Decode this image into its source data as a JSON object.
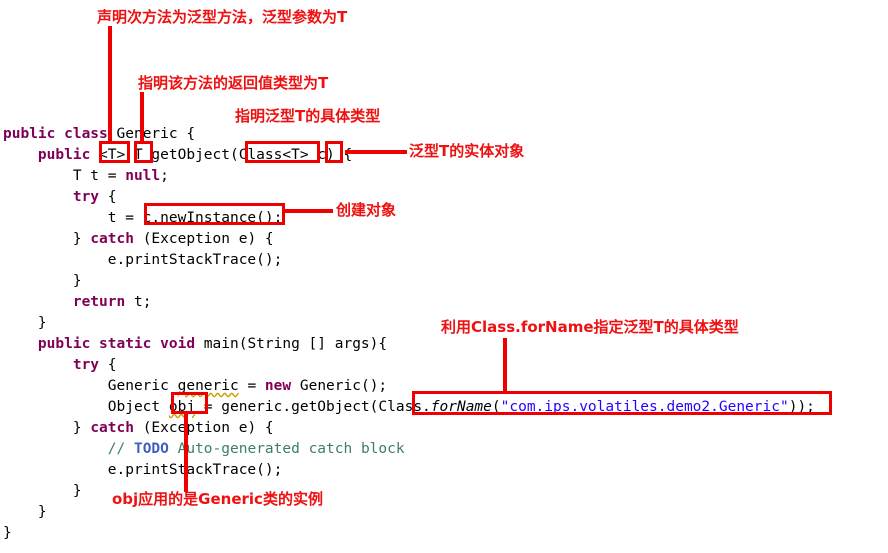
{
  "document": {
    "kind": "java-source-code-screenshot",
    "language": "Java"
  },
  "code": {
    "lines": [
      {
        "id": "l1",
        "text": "public class Generic {"
      },
      {
        "id": "l2",
        "text": "    public <T> T getObject(Class<T> c) {"
      },
      {
        "id": "l3",
        "text": "        T t = null;"
      },
      {
        "id": "l4",
        "text": "        try {"
      },
      {
        "id": "l5",
        "text": "            t = c.newInstance();"
      },
      {
        "id": "l6",
        "text": "        } catch (Exception e) {"
      },
      {
        "id": "l7",
        "text": "            e.printStackTrace();"
      },
      {
        "id": "l8",
        "text": "        }"
      },
      {
        "id": "l9",
        "text": "        return t;"
      },
      {
        "id": "l10",
        "text": "    }"
      },
      {
        "id": "l11",
        "text": ""
      },
      {
        "id": "l12",
        "text": "    public static void main(String [] args){"
      },
      {
        "id": "l13",
        "text": "        try {"
      },
      {
        "id": "l14",
        "text": "            Generic generic = new Generic();"
      },
      {
        "id": "l15",
        "text": "            Object obj = generic.getObject(Class.forName(\"com.ips.volatiles.demo2.Generic\"));"
      },
      {
        "id": "l16",
        "text": "        } catch (Exception e) {"
      },
      {
        "id": "l17",
        "text": "            // TODO Auto-generated catch block"
      },
      {
        "id": "l18",
        "text": "            e.printStackTrace();"
      },
      {
        "id": "l19",
        "text": "        }"
      },
      {
        "id": "l20",
        "text": "    }"
      },
      {
        "id": "l21",
        "text": "}"
      }
    ],
    "tokens": {
      "kw_public": "public",
      "kw_class": "class",
      "kw_static": "static",
      "kw_void": "void",
      "kw_null": "null",
      "kw_try": "try",
      "kw_catch": "catch",
      "kw_return": "return",
      "kw_new": "new",
      "type_generic": "Generic",
      "method_getObject": "getObject",
      "method_newInstance": "newInstance",
      "method_printStackTrace": "printStackTrace",
      "method_forName": "forName",
      "type_class": "Class",
      "type_object": "Object",
      "type_exception": "Exception",
      "type_string": "String",
      "var_t": "t",
      "var_c": "c",
      "var_e": "e",
      "var_obj": "obj",
      "var_generic": "generic",
      "var_args": "args",
      "type_param": "T",
      "string_literal": "\"com.ips.volatiles.demo2.Generic\"",
      "comment_todo": "// TODO Auto-generated catch block",
      "todo_word": "TODO"
    },
    "line_strings": {
      "l1_a": "public",
      "l1_b": " class ",
      "l1_c": "Generic {",
      "l2_a": "    public ",
      "l2_b": "<T> T ",
      "l2_c": "getObject(Class<T> c) {",
      "l3_a": "        T t = ",
      "l3_b": "null",
      "l3_c": ";",
      "l4_a": "        ",
      "l4_b": "try",
      "l4_c": " {",
      "l5_a": "            t = c.newInstance();",
      "l6_a": "        } ",
      "l6_b": "catch",
      "l6_c": " (Exception e) {",
      "l7_a": "            e.printStackTrace();",
      "l8_a": "        }",
      "l9_a": "        ",
      "l9_b": "return",
      "l9_c": " t;",
      "l10_a": "    }",
      "l12_a": "    ",
      "l12_b": "public static void ",
      "l12_c": "main(String [] args){",
      "l13_a": "        ",
      "l13_b": "try",
      "l13_c": " {",
      "l14_a": "            Generic ",
      "l14_b": "generic",
      "l14_c": " = ",
      "l14_d": "new",
      "l14_e": " Generic();",
      "l15_a": "            Object ",
      "l15_b": "obj",
      "l15_c": " = generic.getObject(Class.",
      "l15_d": "forName",
      "l15_e": "(",
      "l15_f": "\"com.ips.volatiles.demo2.Generic\"",
      "l15_g": "));",
      "l16_a": "        } ",
      "l16_b": "catch",
      "l16_c": " (Exception e) {",
      "l17_a": "            ",
      "l17_b": "// ",
      "l17_c": "TODO",
      "l17_d": " Auto-generated catch block",
      "l18_a": "            e.printStackTrace();",
      "l19_a": "        }",
      "l20_a": "    }",
      "l21_a": "}"
    }
  },
  "annotations": {
    "color": "#ee1111",
    "box_color": "#ee0000",
    "labels": [
      {
        "id": "ann1",
        "text": "声明次方法为泛型方法，泛型参数为T",
        "target": "<T> type parameter declaration"
      },
      {
        "id": "ann2",
        "text": "指明该方法的返回值类型为T",
        "target": "T return type"
      },
      {
        "id": "ann3",
        "text": "指明泛型T的具体类型",
        "target": "Class<T> parameter"
      },
      {
        "id": "ann4",
        "text": "泛型T的实体对象",
        "target": "c parameter variable"
      },
      {
        "id": "ann5",
        "text": "创建对象",
        "target": "c.newInstance()"
      },
      {
        "id": "ann6",
        "text": "利用Class.forName指定泛型T的具体类型",
        "target": "Class.forName(...) call"
      },
      {
        "id": "ann7",
        "text": "obj应用的是Generic类的实例",
        "target": "obj variable"
      }
    ],
    "boxes": [
      {
        "id": "box-type-param-decl",
        "label": "<T>"
      },
      {
        "id": "box-return-type",
        "label": "T"
      },
      {
        "id": "box-class-param",
        "label": "Class<T>"
      },
      {
        "id": "box-param-c",
        "label": "c"
      },
      {
        "id": "box-new-instance",
        "label": "c.newInstance()"
      },
      {
        "id": "box-for-name",
        "label": "Class.forName(\"com.ips.volatiles.demo2.Generic\")"
      },
      {
        "id": "box-obj",
        "label": "obj"
      }
    ]
  }
}
